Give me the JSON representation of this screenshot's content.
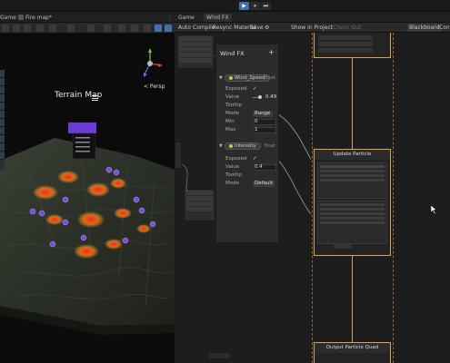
{
  "playbar": {
    "play": "▶",
    "pause": "⏸",
    "step": "⏭"
  },
  "scene": {
    "tabs": {
      "game": "Game",
      "file": "Fire map*"
    },
    "terrain_title": "Terrain Map",
    "persp": "< Persp"
  },
  "graph": {
    "tabs": {
      "game": "Game",
      "wind": "Wind FX"
    },
    "toolbar": {
      "auto": "Auto",
      "compile": "Compile",
      "resync": "Resync Material",
      "save": "Save",
      "show_in_project": "Show in Project",
      "checkout": "Check Out",
      "blackboard": "Blackboard",
      "cont": "Cont"
    },
    "blackboard": {
      "title": "Wind FX",
      "plus": "+",
      "props": [
        {
          "name": "Wind_Speed",
          "type": "float",
          "exposed_label": "Exposed",
          "exposed": "✓",
          "value_label": "Value",
          "value": "0.49",
          "tooltip_label": "Tooltip",
          "mode_label": "Mode",
          "mode": "Range",
          "min_label": "Min",
          "min": "0",
          "max_label": "Max",
          "max": "1"
        },
        {
          "name": "Intensity",
          "type": "float",
          "exposed_label": "Exposed",
          "exposed": "✓",
          "value_label": "Value",
          "value": "0.4",
          "tooltip_label": "Tooltip",
          "mode_label": "Mode",
          "mode": "Default"
        }
      ]
    },
    "contexts": {
      "update": "Update Particle",
      "output": "Output Particle Quad"
    }
  },
  "colors": {
    "accent_blue": "#3d6ea8",
    "context_border": "#d9a441",
    "float_dot": "#b5d54a",
    "marker_purple": "#6a3bd6"
  }
}
